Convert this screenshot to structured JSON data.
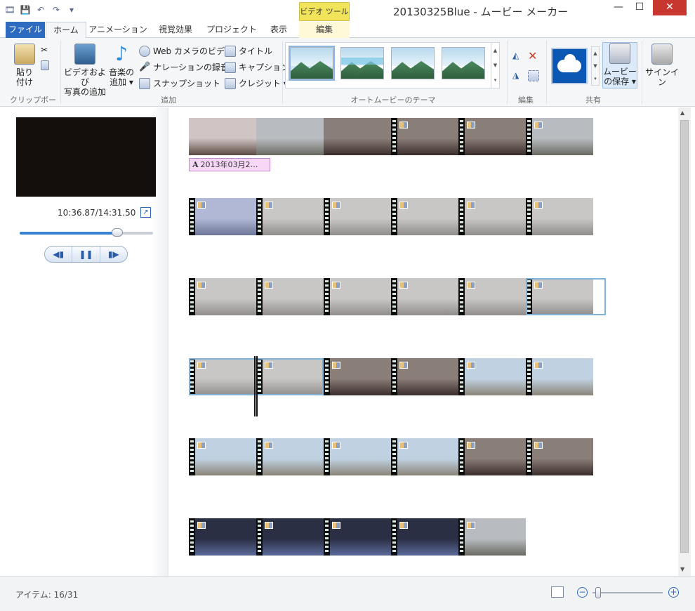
{
  "window": {
    "title": "20130325Blue - ムービー メーカー",
    "context_tab_group": "ビデオ ツール",
    "min": "—",
    "max": "☐",
    "close": "✕"
  },
  "tabs": {
    "file": "ファイル",
    "home": "ホーム",
    "animation": "アニメーション",
    "visual_effects": "視覚効果",
    "project": "プロジェクト",
    "view": "表示",
    "edit": "編集"
  },
  "ribbon": {
    "clipboard": {
      "paste": "貼り\n付け",
      "label": "クリップボード"
    },
    "add": {
      "add_media_l1": "ビデオおよび",
      "add_media_l2": "写真の追加",
      "add_music_l1": "音楽の",
      "add_music_l2": "追加 ▾",
      "webcam": "Web カメラのビデオ",
      "narration": "ナレーションの録音 ▾",
      "snapshot": "スナップショット",
      "title": "タイトル",
      "caption": "キャプション",
      "credits": "クレジット ▾",
      "label": "追加"
    },
    "themes": {
      "label": "オートムービーのテーマ"
    },
    "edit": {
      "label": "編集"
    },
    "share": {
      "save_l1": "ムービー",
      "save_l2": "の保存 ▾",
      "label": "共有"
    },
    "signin": "サインイン"
  },
  "preview": {
    "time": "10:36.87/14:31.50",
    "seek_fraction": 0.73
  },
  "storyboard": {
    "caption_text": "2013年03月2…"
  },
  "status": {
    "items": "アイテム: 16/31"
  },
  "zoom": {
    "level_fraction": 0.08
  },
  "colors": {
    "accent": "#2c6bc0",
    "selection": "#7fb3d9",
    "caption": "#f6d8f6"
  }
}
